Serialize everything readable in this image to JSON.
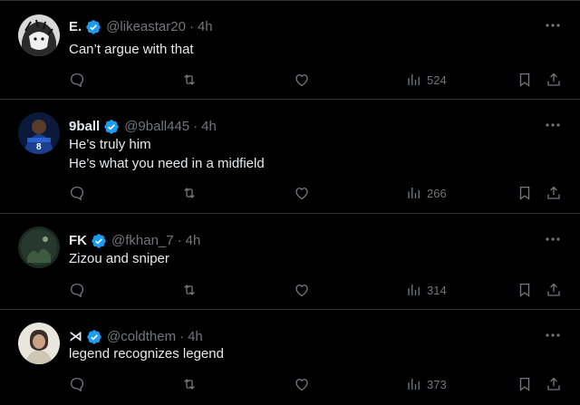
{
  "tweets": [
    {
      "name": "E.",
      "handle": "@likeastar20",
      "time": "4h",
      "text": "Can’t argue with that",
      "views": "524",
      "avatar": "manga-avatar"
    },
    {
      "name": "9ball",
      "handle": "@9ball445",
      "time": "4h",
      "text": "He’s truly him\nHe’s what you need in a midfield",
      "views": "266",
      "avatar": "football-player-avatar"
    },
    {
      "name": "FK",
      "handle": "@fkhan_7",
      "time": "4h",
      "text": "Zizou and sniper",
      "views": "314",
      "avatar": "dark-scene-avatar"
    },
    {
      "name": "⋊",
      "handle": "@coldthem",
      "time": "4h",
      "text": "legend recognizes legend",
      "views": "373",
      "avatar": "person-photo-avatar"
    }
  ],
  "separator": "·",
  "colors": {
    "background": "#000000",
    "text_primary": "#e7e9ea",
    "text_secondary": "#71767b",
    "verified_blue": "#1d9bf0",
    "divider": "#2f3336"
  },
  "icons": [
    "reply-icon",
    "retweet-icon",
    "like-icon",
    "views-icon",
    "bookmark-icon",
    "share-icon",
    "more-icon",
    "verified-badge-icon"
  ]
}
